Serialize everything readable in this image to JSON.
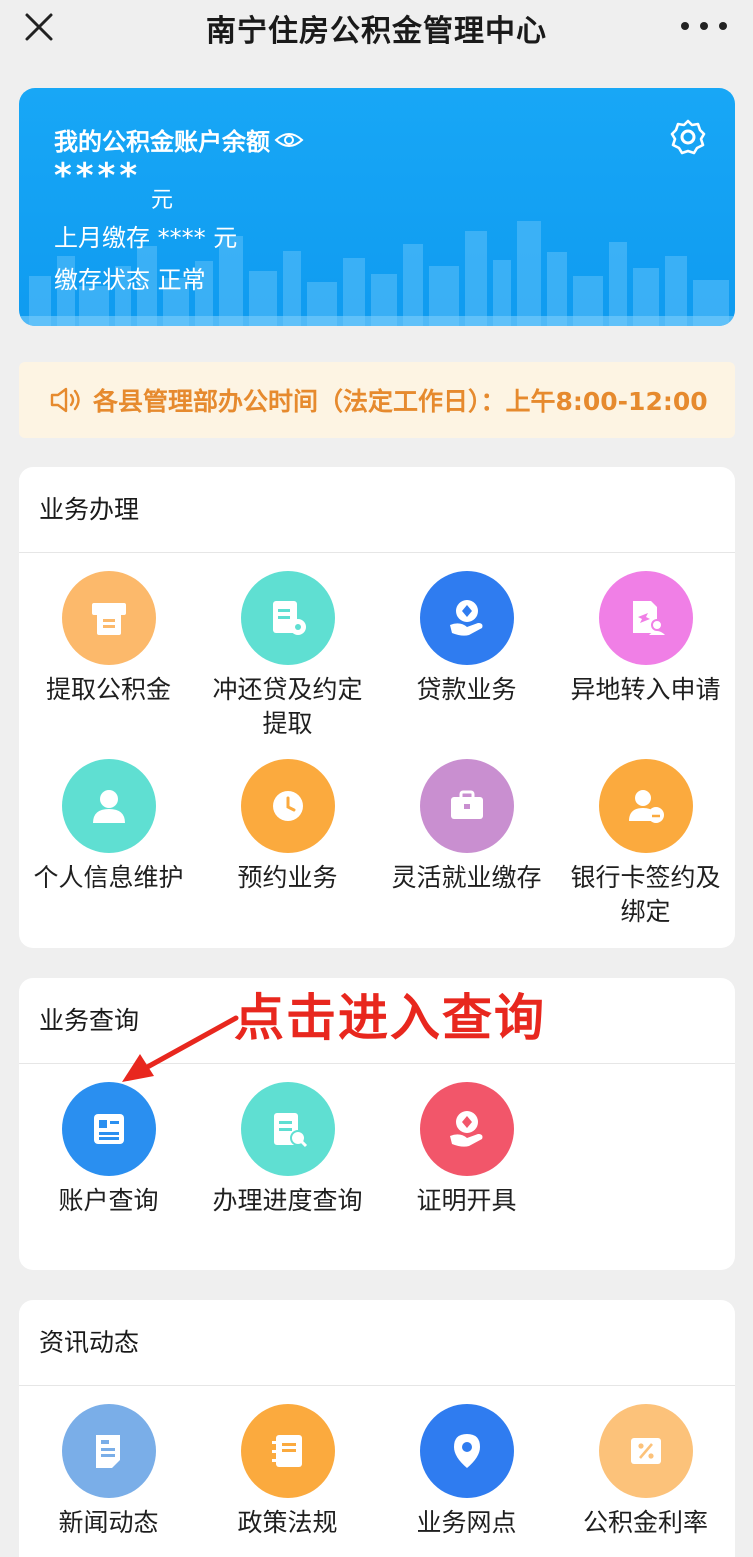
{
  "header": {
    "title": "南宁住房公积金管理中心"
  },
  "balance_card": {
    "title": "我的公积金账户余额",
    "balance_masked": "****",
    "unit": "元",
    "last_month_deposit": "上月缴存 **** 元",
    "deposit_status": "缴存状态 正常"
  },
  "notice": {
    "text": "各县管理部办公时间（法定工作日）：上午8:00-12:00"
  },
  "services": {
    "title": "业务办理",
    "items": [
      {
        "label": "提取公积金"
      },
      {
        "label": "冲还贷及约定提取"
      },
      {
        "label": "贷款业务"
      },
      {
        "label": "异地转入申请"
      },
      {
        "label": "个人信息维护"
      },
      {
        "label": "预约业务"
      },
      {
        "label": "灵活就业缴存"
      },
      {
        "label": "银行卡签约及绑定"
      }
    ]
  },
  "queries": {
    "title": "业务查询",
    "items": [
      {
        "label": "账户查询"
      },
      {
        "label": "办理进度查询"
      },
      {
        "label": "证明开具"
      }
    ]
  },
  "news": {
    "title": "资讯动态",
    "items": [
      {
        "label": "新闻动态"
      },
      {
        "label": "政策法规"
      },
      {
        "label": "业务网点"
      },
      {
        "label": "公积金利率"
      }
    ]
  },
  "annotation": {
    "text": "点击进入查询"
  },
  "colors": {
    "card_blue": "#13a1f3",
    "notice_orange": "#e68a2e",
    "annotation_red": "#e8271e"
  }
}
